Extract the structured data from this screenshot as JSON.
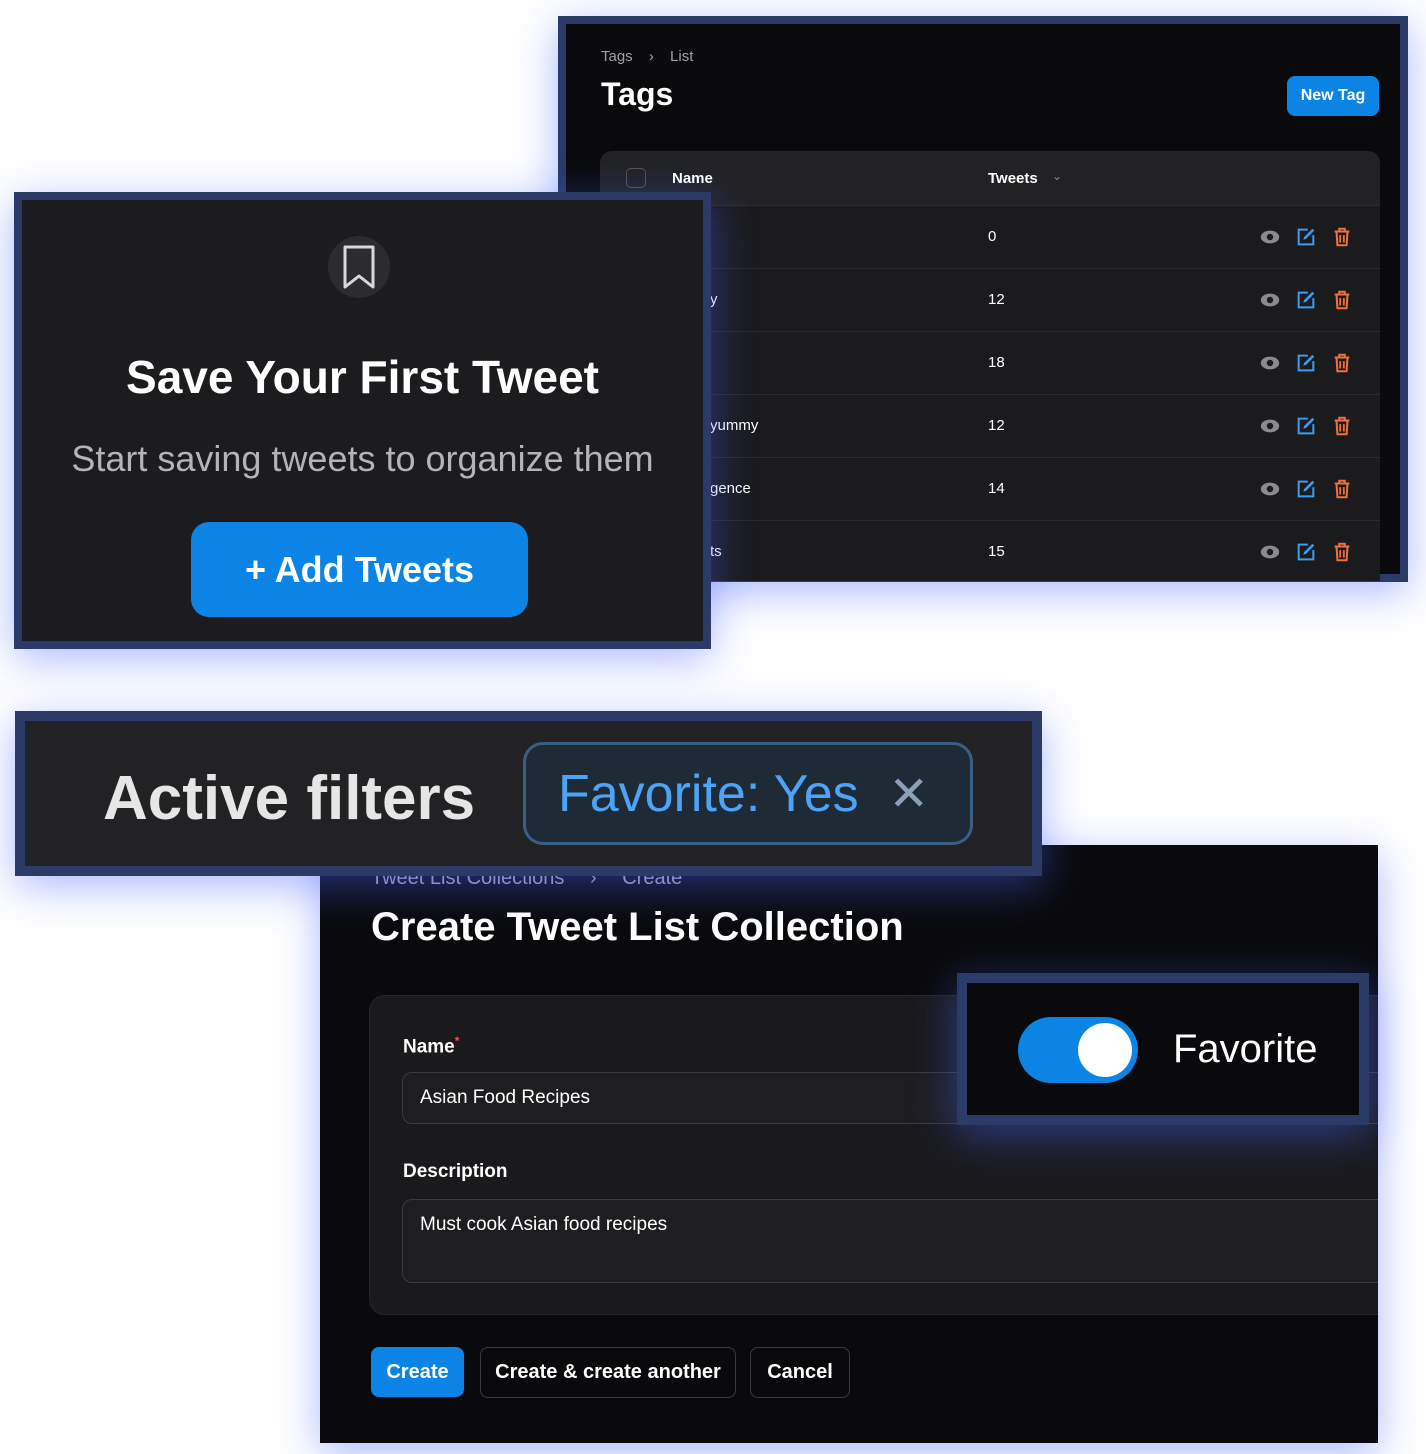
{
  "tags_page": {
    "breadcrumb": [
      "Tags",
      "List"
    ],
    "title": "Tags",
    "new_button": "New Tag",
    "columns": {
      "name": "Name",
      "tweets": "Tweets"
    },
    "rows": [
      {
        "name": "",
        "tweets": "0"
      },
      {
        "name": "y",
        "tweets": "12"
      },
      {
        "name": "",
        "tweets": "18"
      },
      {
        "name": "yummy",
        "tweets": "12"
      },
      {
        "name": "gence",
        "tweets": "14"
      },
      {
        "name": "ts",
        "tweets": "15"
      }
    ],
    "colors": {
      "view": "#8a8a90",
      "edit": "#3b9cf0",
      "delete": "#f0703a"
    }
  },
  "empty_state": {
    "icon": "bookmark-icon",
    "title": "Save Your First Tweet",
    "subtitle": "Start saving tweets to organize them",
    "button": "+ Add Tweets"
  },
  "filters": {
    "label": "Active filters",
    "chip": "Favorite: Yes"
  },
  "create_form": {
    "breadcrumb": [
      "Tweet List Collections",
      "Create"
    ],
    "title": "Create Tweet List Collection",
    "name_label": "Name",
    "required": "*",
    "name_value": "Asian Food Recipes",
    "description_label": "Description",
    "description_value": "Must cook Asian food recipes",
    "buttons": {
      "create": "Create",
      "create_another": "Create & create another",
      "cancel": "Cancel"
    }
  },
  "favorite": {
    "label": "Favorite",
    "enabled": true
  },
  "accent": "#0b84e6"
}
